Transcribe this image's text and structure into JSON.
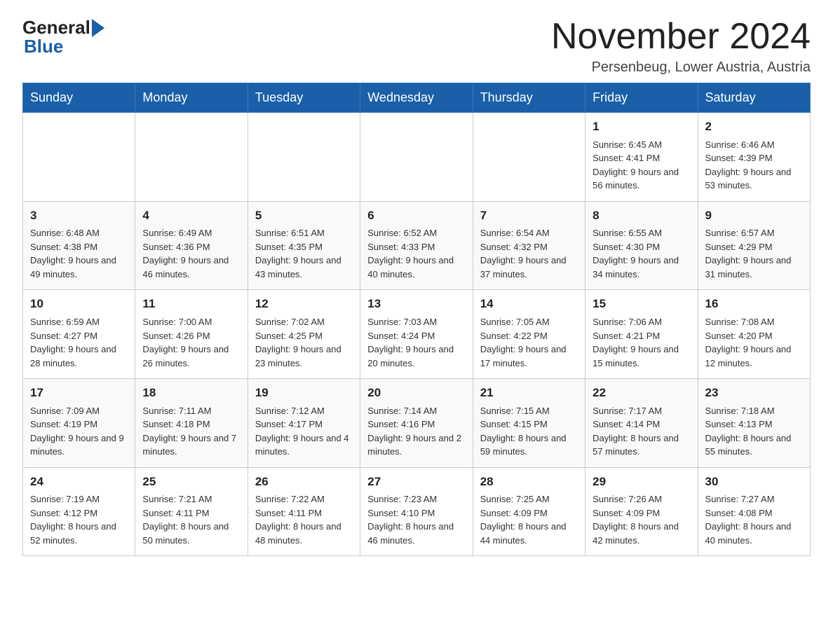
{
  "header": {
    "logo_general": "General",
    "logo_blue": "Blue",
    "month_title": "November 2024",
    "location": "Persenbeug, Lower Austria, Austria"
  },
  "weekdays": [
    "Sunday",
    "Monday",
    "Tuesday",
    "Wednesday",
    "Thursday",
    "Friday",
    "Saturday"
  ],
  "weeks": [
    [
      {
        "day": "",
        "info": ""
      },
      {
        "day": "",
        "info": ""
      },
      {
        "day": "",
        "info": ""
      },
      {
        "day": "",
        "info": ""
      },
      {
        "day": "",
        "info": ""
      },
      {
        "day": "1",
        "info": "Sunrise: 6:45 AM\nSunset: 4:41 PM\nDaylight: 9 hours and 56 minutes."
      },
      {
        "day": "2",
        "info": "Sunrise: 6:46 AM\nSunset: 4:39 PM\nDaylight: 9 hours and 53 minutes."
      }
    ],
    [
      {
        "day": "3",
        "info": "Sunrise: 6:48 AM\nSunset: 4:38 PM\nDaylight: 9 hours and 49 minutes."
      },
      {
        "day": "4",
        "info": "Sunrise: 6:49 AM\nSunset: 4:36 PM\nDaylight: 9 hours and 46 minutes."
      },
      {
        "day": "5",
        "info": "Sunrise: 6:51 AM\nSunset: 4:35 PM\nDaylight: 9 hours and 43 minutes."
      },
      {
        "day": "6",
        "info": "Sunrise: 6:52 AM\nSunset: 4:33 PM\nDaylight: 9 hours and 40 minutes."
      },
      {
        "day": "7",
        "info": "Sunrise: 6:54 AM\nSunset: 4:32 PM\nDaylight: 9 hours and 37 minutes."
      },
      {
        "day": "8",
        "info": "Sunrise: 6:55 AM\nSunset: 4:30 PM\nDaylight: 9 hours and 34 minutes."
      },
      {
        "day": "9",
        "info": "Sunrise: 6:57 AM\nSunset: 4:29 PM\nDaylight: 9 hours and 31 minutes."
      }
    ],
    [
      {
        "day": "10",
        "info": "Sunrise: 6:59 AM\nSunset: 4:27 PM\nDaylight: 9 hours and 28 minutes."
      },
      {
        "day": "11",
        "info": "Sunrise: 7:00 AM\nSunset: 4:26 PM\nDaylight: 9 hours and 26 minutes."
      },
      {
        "day": "12",
        "info": "Sunrise: 7:02 AM\nSunset: 4:25 PM\nDaylight: 9 hours and 23 minutes."
      },
      {
        "day": "13",
        "info": "Sunrise: 7:03 AM\nSunset: 4:24 PM\nDaylight: 9 hours and 20 minutes."
      },
      {
        "day": "14",
        "info": "Sunrise: 7:05 AM\nSunset: 4:22 PM\nDaylight: 9 hours and 17 minutes."
      },
      {
        "day": "15",
        "info": "Sunrise: 7:06 AM\nSunset: 4:21 PM\nDaylight: 9 hours and 15 minutes."
      },
      {
        "day": "16",
        "info": "Sunrise: 7:08 AM\nSunset: 4:20 PM\nDaylight: 9 hours and 12 minutes."
      }
    ],
    [
      {
        "day": "17",
        "info": "Sunrise: 7:09 AM\nSunset: 4:19 PM\nDaylight: 9 hours and 9 minutes."
      },
      {
        "day": "18",
        "info": "Sunrise: 7:11 AM\nSunset: 4:18 PM\nDaylight: 9 hours and 7 minutes."
      },
      {
        "day": "19",
        "info": "Sunrise: 7:12 AM\nSunset: 4:17 PM\nDaylight: 9 hours and 4 minutes."
      },
      {
        "day": "20",
        "info": "Sunrise: 7:14 AM\nSunset: 4:16 PM\nDaylight: 9 hours and 2 minutes."
      },
      {
        "day": "21",
        "info": "Sunrise: 7:15 AM\nSunset: 4:15 PM\nDaylight: 8 hours and 59 minutes."
      },
      {
        "day": "22",
        "info": "Sunrise: 7:17 AM\nSunset: 4:14 PM\nDaylight: 8 hours and 57 minutes."
      },
      {
        "day": "23",
        "info": "Sunrise: 7:18 AM\nSunset: 4:13 PM\nDaylight: 8 hours and 55 minutes."
      }
    ],
    [
      {
        "day": "24",
        "info": "Sunrise: 7:19 AM\nSunset: 4:12 PM\nDaylight: 8 hours and 52 minutes."
      },
      {
        "day": "25",
        "info": "Sunrise: 7:21 AM\nSunset: 4:11 PM\nDaylight: 8 hours and 50 minutes."
      },
      {
        "day": "26",
        "info": "Sunrise: 7:22 AM\nSunset: 4:11 PM\nDaylight: 8 hours and 48 minutes."
      },
      {
        "day": "27",
        "info": "Sunrise: 7:23 AM\nSunset: 4:10 PM\nDaylight: 8 hours and 46 minutes."
      },
      {
        "day": "28",
        "info": "Sunrise: 7:25 AM\nSunset: 4:09 PM\nDaylight: 8 hours and 44 minutes."
      },
      {
        "day": "29",
        "info": "Sunrise: 7:26 AM\nSunset: 4:09 PM\nDaylight: 8 hours and 42 minutes."
      },
      {
        "day": "30",
        "info": "Sunrise: 7:27 AM\nSunset: 4:08 PM\nDaylight: 8 hours and 40 minutes."
      }
    ]
  ]
}
